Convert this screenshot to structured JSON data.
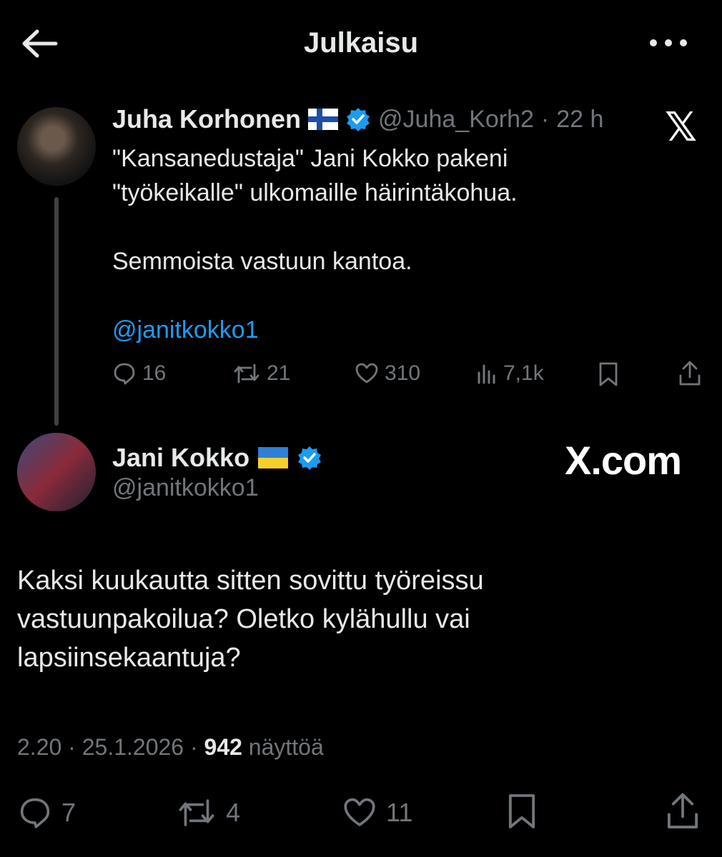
{
  "header": {
    "title": "Julkaisu"
  },
  "tweet1": {
    "name": "Juha Korhonen",
    "handle": "@Juha_Korh2",
    "sep": "·",
    "time": "22 h",
    "line1": "\"Kansanedustaja\" Jani Kokko pakeni",
    "line2": "\"työkeikalle\" ulkomaille häirintäkohua.",
    "line3": "Semmoista vastuun kantoa.",
    "mention": "@janitkokko1",
    "replies": "16",
    "reposts": "21",
    "likes": "310",
    "views": "7,1k"
  },
  "tweet2": {
    "name": "Jani Kokko",
    "handle": "@janitkokko1",
    "line1": "Kaksi kuukautta sitten sovittu työreissu",
    "line2": "vastuunpakoilua? Oletko kylähullu vai",
    "line3": "lapsiinsekaantuja?",
    "time": "2.20",
    "sep": "·",
    "date": "25.1.2026",
    "views_count": "942",
    "views_label": "näyttöä",
    "replies": "7",
    "reposts": "4",
    "likes": "11"
  },
  "watermarks": {
    "x_logo": "𝕏",
    "x_com": "X.com"
  },
  "colors": {
    "background": "#000000",
    "text": "#e7e9ea",
    "muted": "#71767b",
    "link": "#1d9bf0"
  },
  "icons": [
    "back-arrow-icon",
    "more-icon",
    "verified-icon",
    "reply-icon",
    "repost-icon",
    "like-icon",
    "views-icon",
    "bookmark-icon",
    "share-icon"
  ]
}
